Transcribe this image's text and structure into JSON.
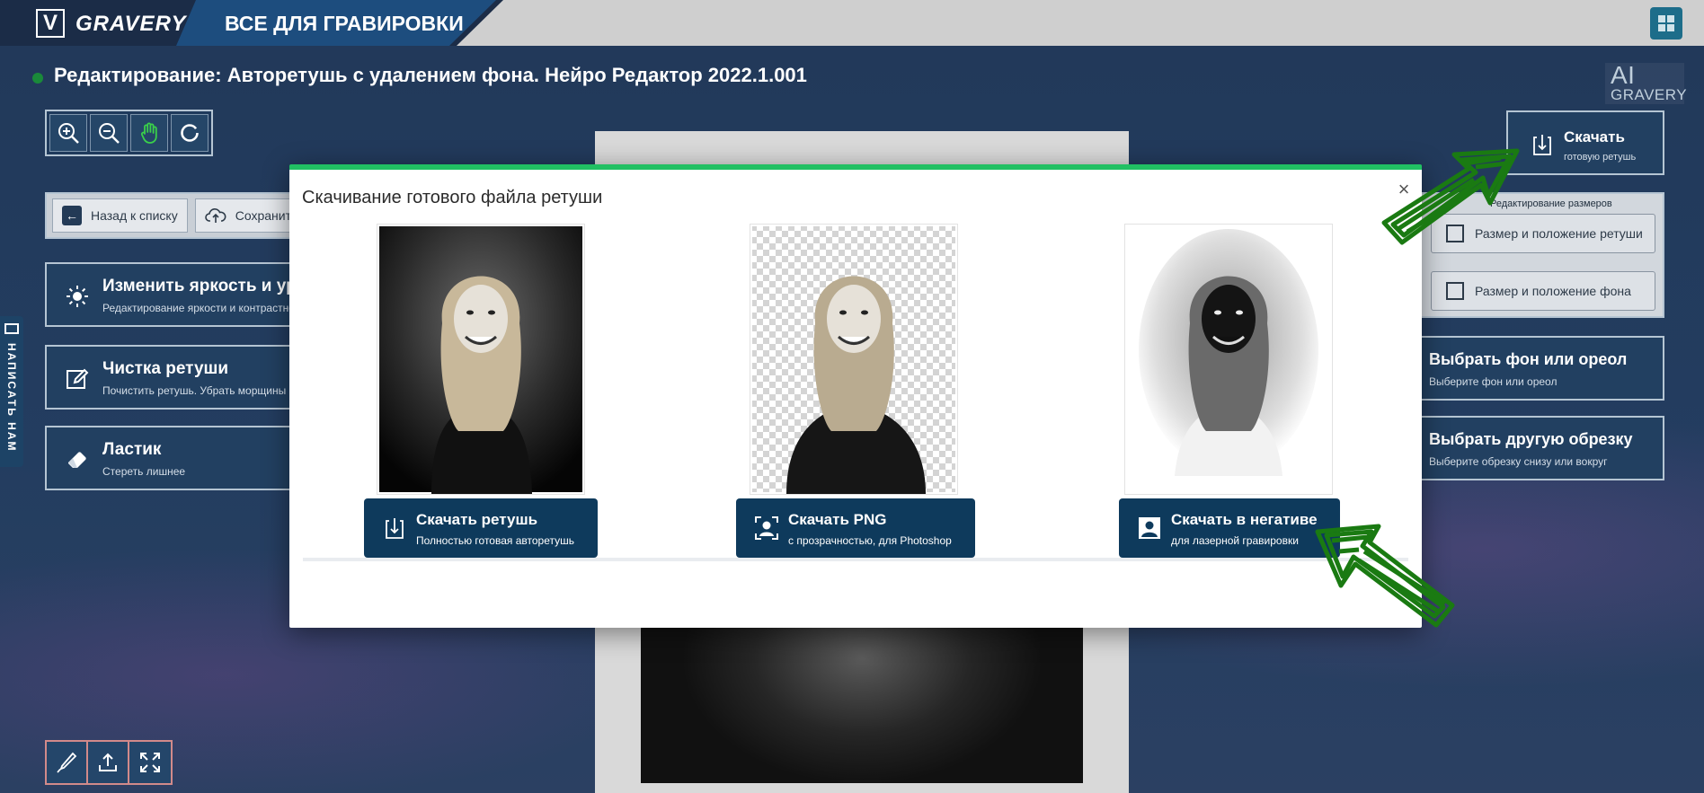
{
  "header": {
    "logo_letter": "V",
    "logo_text": "GRAVERY",
    "slogan": "ВСЕ ДЛЯ ГРАВИРОВКИ"
  },
  "page": {
    "title": "Редактирование: Авторетушь с удалением фона. Нейро Редактор 2022.1.001",
    "ai_logo_top": "AI",
    "ai_logo_bottom": "GRAVERY"
  },
  "left": {
    "back_label": "Назад к списку",
    "save_label": "Сохранить",
    "features": [
      {
        "title": "Изменить яркость и уровни",
        "subtitle": "Редактирование яркости и контрастности"
      },
      {
        "title": "Чистка ретуши",
        "subtitle": "Почистить ретушь. Убрать морщины"
      },
      {
        "title": "Ластик",
        "subtitle": "Стереть лишнее"
      }
    ],
    "contact_tab": "НАПИСАТЬ НАМ"
  },
  "right": {
    "download_title": "Скачать",
    "download_subtitle": "готовую ретушь",
    "size_header": "Редактирование размеров",
    "size_retouch": "Размер и положение ретуши",
    "size_background": "Размер и положение фона",
    "background_title": "Выбрать фон или ореол",
    "background_subtitle": "Выберите фон или ореол",
    "crop_title": "Выбрать другую обрезку",
    "crop_subtitle": "Выберите обрезку снизу или вокруг"
  },
  "modal": {
    "title": "Скачивание готового файла ретуши",
    "close": "×",
    "options": [
      {
        "title": "Скачать ретушь",
        "subtitle": "Полностью готовая авторетушь",
        "icon": "download-icon"
      },
      {
        "title": "Скачать PNG",
        "subtitle": "с прозрачностью, для Photoshop",
        "icon": "person-frame-icon"
      },
      {
        "title": "Скачать в негативе",
        "subtitle": "для лазерной гравировки",
        "icon": "portrait-icon"
      }
    ]
  },
  "colors": {
    "accent": "#21c063",
    "button": "#0e3a5c",
    "panel": "#224061",
    "arrow": "#1a7a12"
  }
}
